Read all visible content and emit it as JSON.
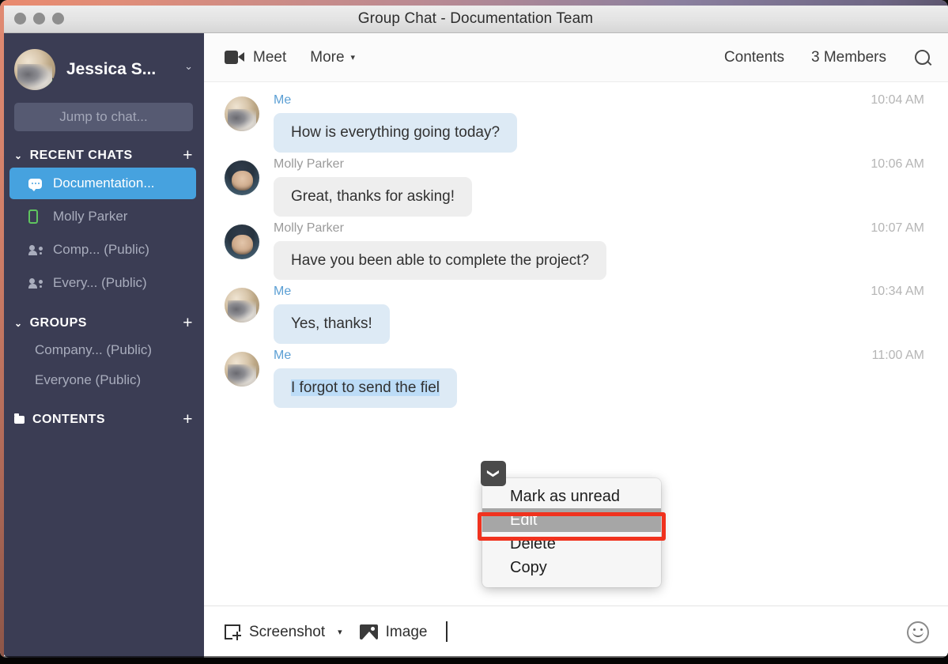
{
  "window": {
    "title": "Group Chat - Documentation Team",
    "traffic_lights": [
      "close",
      "minimize",
      "zoom"
    ]
  },
  "sidebar": {
    "profile": {
      "name": "Jessica S...",
      "status": "online",
      "caret": "⌄"
    },
    "search": {
      "placeholder": "Jump to chat..."
    },
    "sections": [
      {
        "title": "RECENT CHATS",
        "chevron": "⌄",
        "add": "+"
      },
      {
        "title": "GROUPS",
        "chevron": "⌄",
        "add": "+"
      },
      {
        "title": "CONTENTS",
        "icon": "folder-icon",
        "add": "+"
      }
    ],
    "recent_chats": [
      {
        "label": "Documentation...",
        "icon": "chat-bubble-icon",
        "active": true
      },
      {
        "label": "Molly Parker",
        "icon": "mobile-phone-icon",
        "active": false
      },
      {
        "label": "Comp... (Public)",
        "icon": "people-icon",
        "active": false
      },
      {
        "label": "Every... (Public)",
        "icon": "people-icon",
        "active": false
      }
    ],
    "groups": [
      {
        "label": "Company... (Public)"
      },
      {
        "label": "Everyone (Public)"
      }
    ]
  },
  "toolbar": {
    "meet_label": "Meet",
    "more_label": "More",
    "more_caret": "▾",
    "contents_label": "Contents",
    "members_label": "3 Members",
    "search_icon": "search-icon"
  },
  "messages": [
    {
      "author": "Me",
      "is_me": true,
      "time": "10:04 AM",
      "text": "How is everything going today?"
    },
    {
      "author": "Molly Parker",
      "is_me": false,
      "time": "10:06 AM",
      "text": "Great, thanks for asking!"
    },
    {
      "author": "Molly Parker",
      "is_me": false,
      "time": "10:07 AM",
      "text": "Have you been able to complete the project?"
    },
    {
      "author": "Me",
      "is_me": true,
      "time": "10:34 AM",
      "text": "Yes, thanks!"
    },
    {
      "author": "Me",
      "is_me": true,
      "time": "11:00 AM",
      "text": "I forgot to send the fiel",
      "selected": true
    }
  ],
  "context_menu": {
    "toggle_icon": "chevron-down-icon",
    "items": [
      {
        "label": "Mark as unread",
        "highlighted": false
      },
      {
        "label": "Edit",
        "highlighted": true
      },
      {
        "label": "Delete",
        "highlighted": false
      },
      {
        "label": "Copy",
        "highlighted": false
      }
    ],
    "annotation_color": "#f0321e"
  },
  "composer": {
    "screenshot_label": "Screenshot",
    "screenshot_caret": "▾",
    "image_label": "Image",
    "emoji_icon": "smiley-icon"
  },
  "colors": {
    "sidebar_bg": "#3b3d54",
    "accent_blue": "#46a2df",
    "my_bubble": "#ddeaf5",
    "their_bubble": "#eeeeee",
    "selection": "#bcdcf7",
    "highlight_red": "#f0321e",
    "status_green": "#3ecb1e"
  }
}
